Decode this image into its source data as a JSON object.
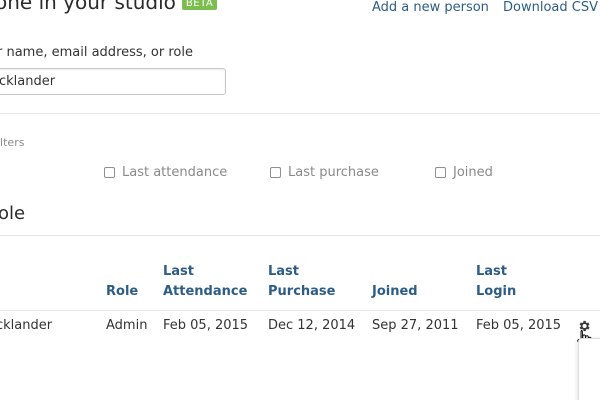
{
  "header": {
    "title": "one in your studio",
    "badge": "BETA",
    "links": [
      "Add a new person",
      "Download CSV"
    ]
  },
  "search": {
    "label": "r name, email address, or role",
    "value": "cklander"
  },
  "filters": {
    "label": "ilters",
    "items": [
      "Last attendance",
      "Last purchase",
      "Joined"
    ]
  },
  "section": {
    "title": "ole"
  },
  "table": {
    "headers": {
      "role": "Role",
      "last_attendance_1": "Last",
      "last_attendance_2": "Attendance",
      "last_purchase_1": "Last",
      "last_purchase_2": "Purchase",
      "joined": "Joined",
      "last_login_1": "Last",
      "last_login_2": "Login"
    },
    "rows": [
      {
        "name": "cklander",
        "role": "Admin",
        "last_attendance": "Feb 05, 2015",
        "last_purchase": "Dec 12, 2014",
        "joined": "Sep 27, 2011",
        "last_login": "Feb 05, 2015"
      }
    ]
  },
  "icons": {
    "settings": "gear-icon",
    "pointer": "hand-pointer-icon"
  },
  "colors": {
    "link": "#2d5d86",
    "badge": "#7cbd4f",
    "muted": "#8a8a8a"
  }
}
